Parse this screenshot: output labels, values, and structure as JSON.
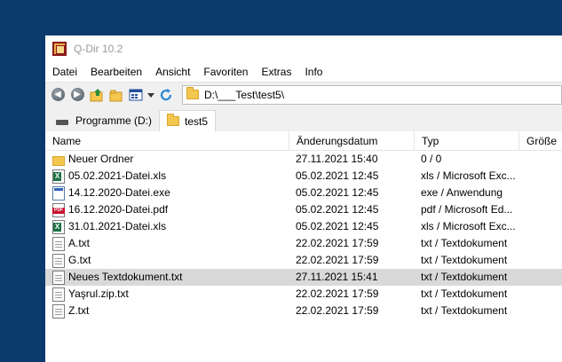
{
  "window": {
    "title": "Q-Dir 10.2"
  },
  "menu": [
    "Datei",
    "Bearbeiten",
    "Ansicht",
    "Favoriten",
    "Extras",
    "Info"
  ],
  "toolbar": {
    "buttons": [
      "back-icon",
      "forward-icon",
      "up-folder-icon",
      "new-folder-icon",
      "view-grid-icon",
      "dropdown-arrow-icon",
      "refresh-icon"
    ],
    "address": "D:\\___Test\\test5\\"
  },
  "tabs": [
    {
      "label": "Programme (D:)",
      "icon": "drive-icon"
    },
    {
      "label": "test5",
      "icon": "folder-icon",
      "active": true
    }
  ],
  "columns": [
    "Name",
    "Änderungsdatum",
    "Typ",
    "Größe"
  ],
  "files": [
    {
      "name": "Neuer Ordner",
      "date": "27.11.2021 15:40",
      "type": "0 / 0",
      "size": "",
      "icon": "folder"
    },
    {
      "name": "05.02.2021-Datei.xls",
      "date": "05.02.2021 12:45",
      "type": "xls / Microsoft Exc...",
      "size": "",
      "icon": "xls"
    },
    {
      "name": "14.12.2020-Datei.exe",
      "date": "05.02.2021 12:45",
      "type": "exe / Anwendung",
      "size": "",
      "icon": "exe"
    },
    {
      "name": "16.12.2020-Datei.pdf",
      "date": "05.02.2021 12:45",
      "type": "pdf / Microsoft Ed...",
      "size": "",
      "icon": "pdf"
    },
    {
      "name": "31.01.2021-Datei.xls",
      "date": "05.02.2021 12:45",
      "type": "xls / Microsoft Exc...",
      "size": "",
      "icon": "xls"
    },
    {
      "name": "A.txt",
      "date": "22.02.2021 17:59",
      "type": "txt / Textdokument",
      "size": "",
      "icon": "doc"
    },
    {
      "name": "G.txt",
      "date": "22.02.2021 17:59",
      "type": "txt / Textdokument",
      "size": "",
      "icon": "doc"
    },
    {
      "name": "Neues Textdokument.txt",
      "date": "27.11.2021 15:41",
      "type": "txt / Textdokument",
      "size": "",
      "icon": "doc",
      "selected": true
    },
    {
      "name": "Yaşrul.zip.txt",
      "date": "22.02.2021 17:59",
      "type": "txt / Textdokument",
      "size": "",
      "icon": "doc"
    },
    {
      "name": "Z.txt",
      "date": "22.02.2021 17:59",
      "type": "txt / Textdokument",
      "size": "",
      "icon": "doc"
    }
  ]
}
